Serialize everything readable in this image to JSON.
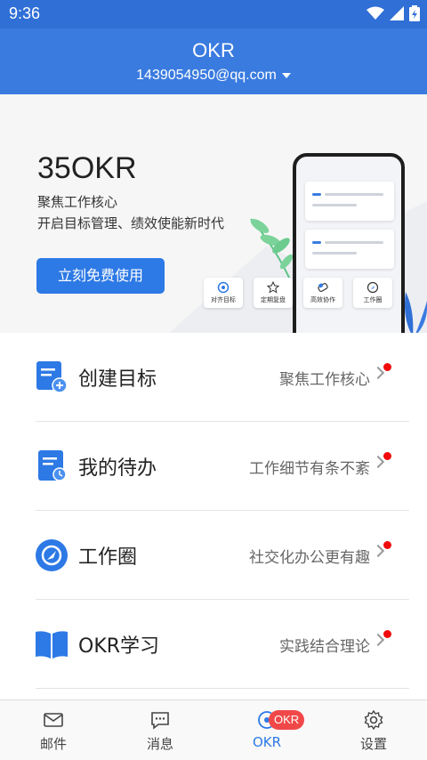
{
  "status_bar": {
    "time": "9:36"
  },
  "header": {
    "title": "OKR",
    "account": "1439054950@qq.com"
  },
  "banner": {
    "title": "35OKR",
    "subtitle1": "聚焦工作核心",
    "subtitle2": "开启目标管理、绩效使能新时代",
    "cta": "立刻免费使用",
    "chips": [
      {
        "label": "对齐目标",
        "icon": "target-icon"
      },
      {
        "label": "定期复盘",
        "icon": "star-icon"
      },
      {
        "label": "高效协作",
        "icon": "handshake-icon"
      },
      {
        "label": "工作圈",
        "icon": "compass-icon"
      }
    ]
  },
  "menu": [
    {
      "label": "创建目标",
      "desc": "聚焦工作核心",
      "icon": "create-goal-icon"
    },
    {
      "label": "我的待办",
      "desc": "工作细节有条不紊",
      "icon": "todo-icon"
    },
    {
      "label": "工作圈",
      "desc": "社交化办公更有趣",
      "icon": "work-circle-icon"
    },
    {
      "label": "OKR学习",
      "desc": "实践结合理论",
      "icon": "book-icon"
    }
  ],
  "tabs": [
    {
      "label": "邮件",
      "icon": "mail-icon"
    },
    {
      "label": "消息",
      "icon": "message-icon"
    },
    {
      "label": "OKR",
      "icon": "okr-icon",
      "badge": "OKR"
    },
    {
      "label": "设置",
      "icon": "gear-icon"
    }
  ],
  "colors": {
    "primary": "#3a7be0",
    "status": "#2f6fd6",
    "cta": "#2d79e5",
    "dot": "#f10a0a"
  }
}
